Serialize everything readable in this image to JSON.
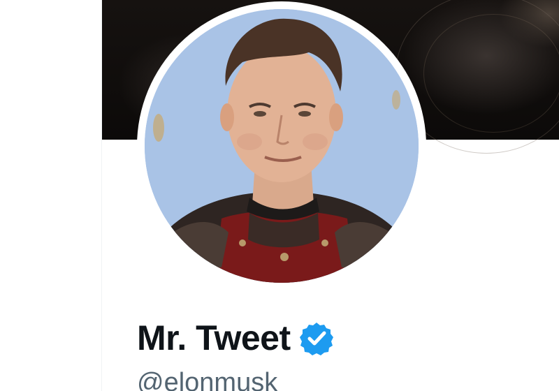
{
  "profile": {
    "display_name": "Mr. Tweet",
    "handle": "@elonmusk",
    "verified": true
  },
  "icons": {
    "verified": "verified-badge-icon"
  },
  "colors": {
    "name_text": "#0f1419",
    "handle_text": "#536471",
    "verified_blue": "#1d9bf0",
    "avatar_background": "#a9c3e6",
    "banner_dark": "#0c0a09"
  }
}
